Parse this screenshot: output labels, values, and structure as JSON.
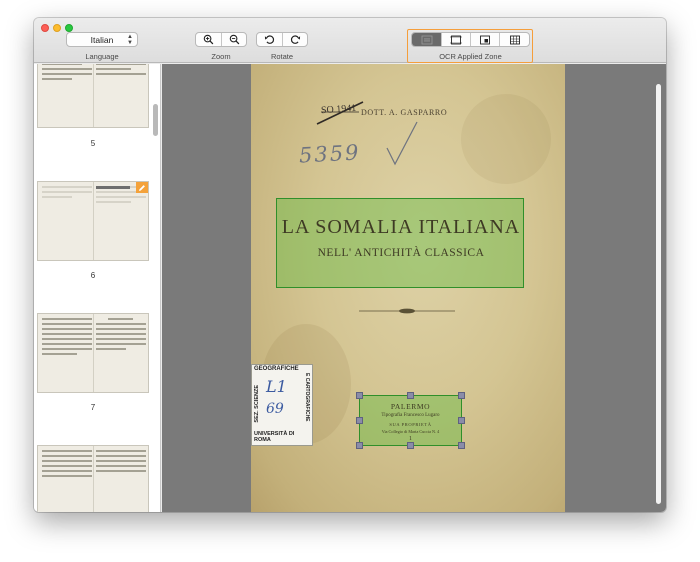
{
  "toolbar": {
    "language": {
      "selected": "Italian",
      "caption": "Language"
    },
    "zoom": {
      "caption": "Zoom",
      "buttons": [
        "zoom-in-icon",
        "zoom-out-icon"
      ]
    },
    "rotate": {
      "caption": "Rotate",
      "buttons": [
        "rotate-left-icon",
        "rotate-right-icon"
      ]
    },
    "ocr_zone": {
      "caption": "OCR Applied Zone",
      "buttons": [
        "text-zone-icon",
        "image-zone-icon",
        "picture-zone-icon",
        "table-zone-icon"
      ]
    }
  },
  "sidebar": {
    "thumbnails": [
      {
        "label": "5",
        "edited": false
      },
      {
        "label": "6",
        "edited": true
      },
      {
        "label": "7",
        "edited": false
      },
      {
        "label": "",
        "edited": false
      }
    ]
  },
  "document": {
    "stamp": "SO 1941",
    "author": "DOTT. A. GASPARRO",
    "handwritten_number": "5359",
    "title_line1": "LA SOMALIA ITALIANA",
    "title_line2": "NELL' ANTICHITÀ CLASSICA",
    "publisher_city": "PALERMO",
    "publisher_line2": "Tipografia Francesco Lugaro",
    "publisher_line3": "SUA PROPRIETÀ",
    "publisher_line4": "Via Collegio di Maria Cuccia N. 4",
    "publisher_year": "1",
    "library_label": {
      "top": "GEOGRAFICHE",
      "side": "SEZ. SCIENZE",
      "right": "E CARTOGRAFICHE",
      "hand_top": "L1",
      "hand_bottom": "69",
      "bottom": "UNIVERSITÀ DI ROMA"
    }
  },
  "colors": {
    "ocr_highlight": "#5cba3c",
    "ocr_frame": "#f59e3b",
    "viewer_bg": "#7a7a7a"
  }
}
